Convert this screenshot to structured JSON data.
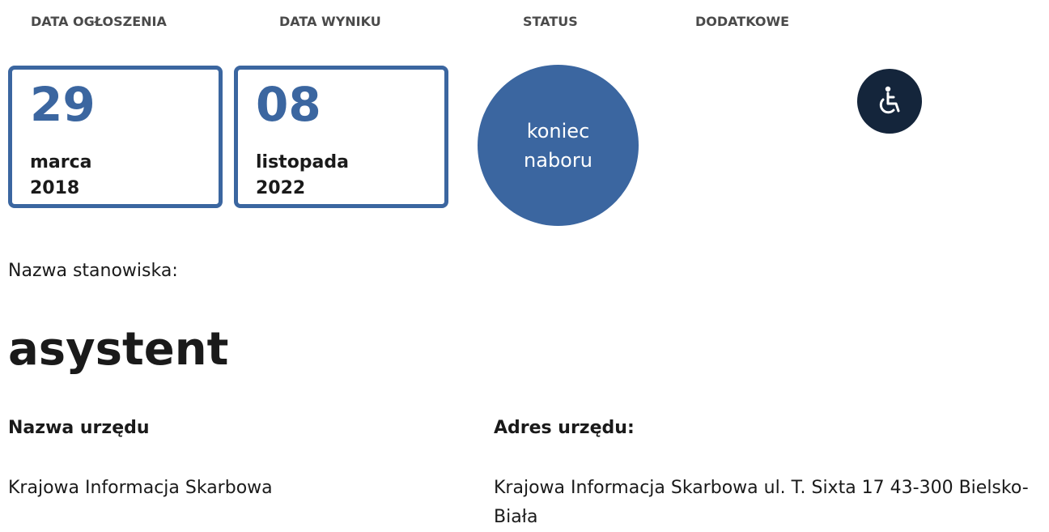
{
  "headers": {
    "announcement_date": "DATA OGŁOSZENIA",
    "result_date": "DATA WYNIKU",
    "status": "STATUS",
    "additional": "DODATKOWE"
  },
  "announcement": {
    "day": "29",
    "month": "marca",
    "year": "2018"
  },
  "result": {
    "day": "08",
    "month": "listopada",
    "year": "2022"
  },
  "status_text": "koniec naboru",
  "additional_icon": "wheelchair-icon",
  "position_label": "Nazwa stanowiska:",
  "position_title": "asystent",
  "office_name_label": "Nazwa urzędu",
  "office_name_value": "Krajowa Informacja Skarbowa",
  "office_address_label": "Adres urzędu:",
  "office_address_value": "Krajowa Informacja Skarbowa ul. T. Sixta 17 43-300 Bielsko-Biała",
  "colors": {
    "accent": "#3b66a0",
    "icon_bg": "#14253b"
  }
}
